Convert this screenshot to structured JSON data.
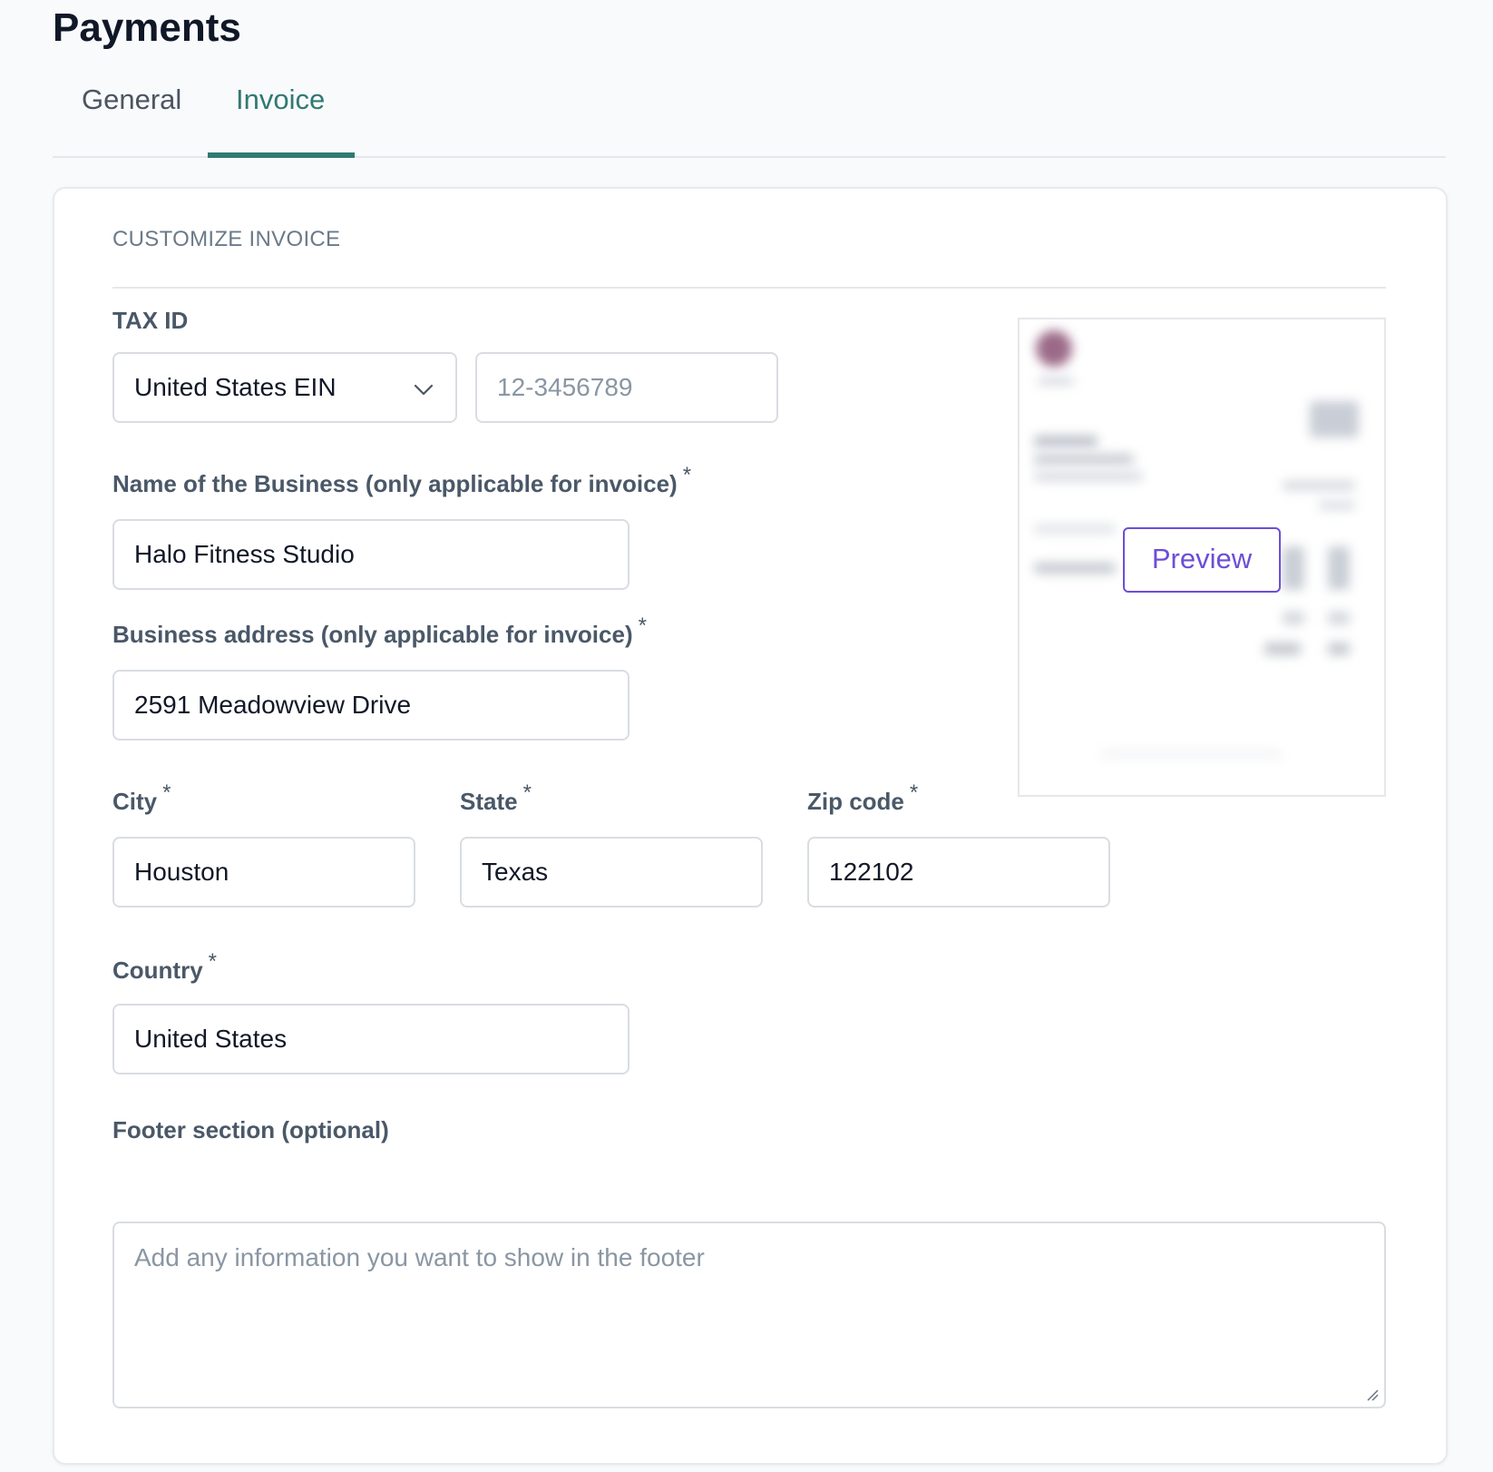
{
  "page": {
    "title": "Payments"
  },
  "tabs": [
    {
      "label": "General",
      "active": false
    },
    {
      "label": "Invoice",
      "active": true
    }
  ],
  "card": {
    "section_title": "CUSTOMIZE INVOICE"
  },
  "tax": {
    "label": "TAX ID",
    "type_value": "United States EIN",
    "id_placeholder": "12-3456789"
  },
  "business_name": {
    "label": "Name of the Business (only applicable for invoice)",
    "required_mark": "*",
    "value": "Halo Fitness Studio"
  },
  "business_address": {
    "label": "Business address (only applicable for invoice)",
    "required_mark": "*",
    "value": "2591 Meadowview Drive"
  },
  "city": {
    "label": "City",
    "required_mark": "*",
    "value": "Houston"
  },
  "state": {
    "label": "State",
    "required_mark": "*",
    "value": "Texas"
  },
  "zip": {
    "label": "Zip code",
    "required_mark": "*",
    "value": "122102"
  },
  "country": {
    "label": "Country",
    "required_mark": "*",
    "value": "United States"
  },
  "footer": {
    "label": "Footer section (optional)",
    "placeholder": "Add any information you want to show in the footer"
  },
  "preview": {
    "button_label": "Preview"
  },
  "colors": {
    "accent_teal": "#2f7a73",
    "preview_purple": "#6d4dd8",
    "label_gray": "#4a5868",
    "border": "#d9dde2"
  },
  "icons": {
    "select": "chevron-down-icon",
    "textarea": "resize-handle-icon"
  }
}
